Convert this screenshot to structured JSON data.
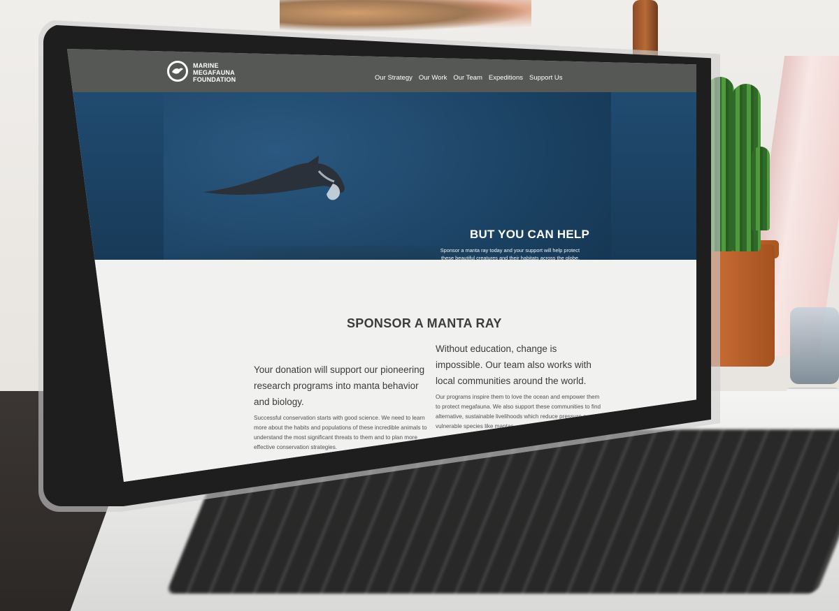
{
  "brand": {
    "line1": "MARINE",
    "line2": "MEGAFAUNA",
    "line3": "FOUNDATION"
  },
  "nav": {
    "items": [
      "Our Strategy",
      "Our Work",
      "Our Team",
      "Expeditions",
      "Support Us"
    ]
  },
  "hero": {
    "heading": "BUT YOU CAN HELP",
    "subtext": "Sponsor a manta ray today and your support will help protect these beautiful creatures and their habitats across the globe."
  },
  "section": {
    "title": "SPONSOR A MANTA RAY"
  },
  "columns": {
    "left": {
      "heading": "Your donation will support our pioneering research programs into manta behavior and biology.",
      "body": "Successful conservation starts with good science. We need to learn more about the habits and populations of these incredible animals to understand the most significant threats to them and to plan more effective conservation strategies."
    },
    "right": {
      "heading": "Without education, change is impossible. Our team also works with local communities around the world.",
      "body": "Our programs inspire them to love the ocean and empower them to protect megafauna. We also support these communities to find alternative, sustainable livelihoods which reduce pressure on vulnerable species like mantas."
    }
  },
  "colors": {
    "navbar": "#555855",
    "hero_ocean": "#1b4263",
    "content_bg": "#f1f1ef",
    "text_dark": "#3c3c3c",
    "white": "#ffffff"
  },
  "icons": {
    "logo": "manta-ray-circle-icon"
  }
}
